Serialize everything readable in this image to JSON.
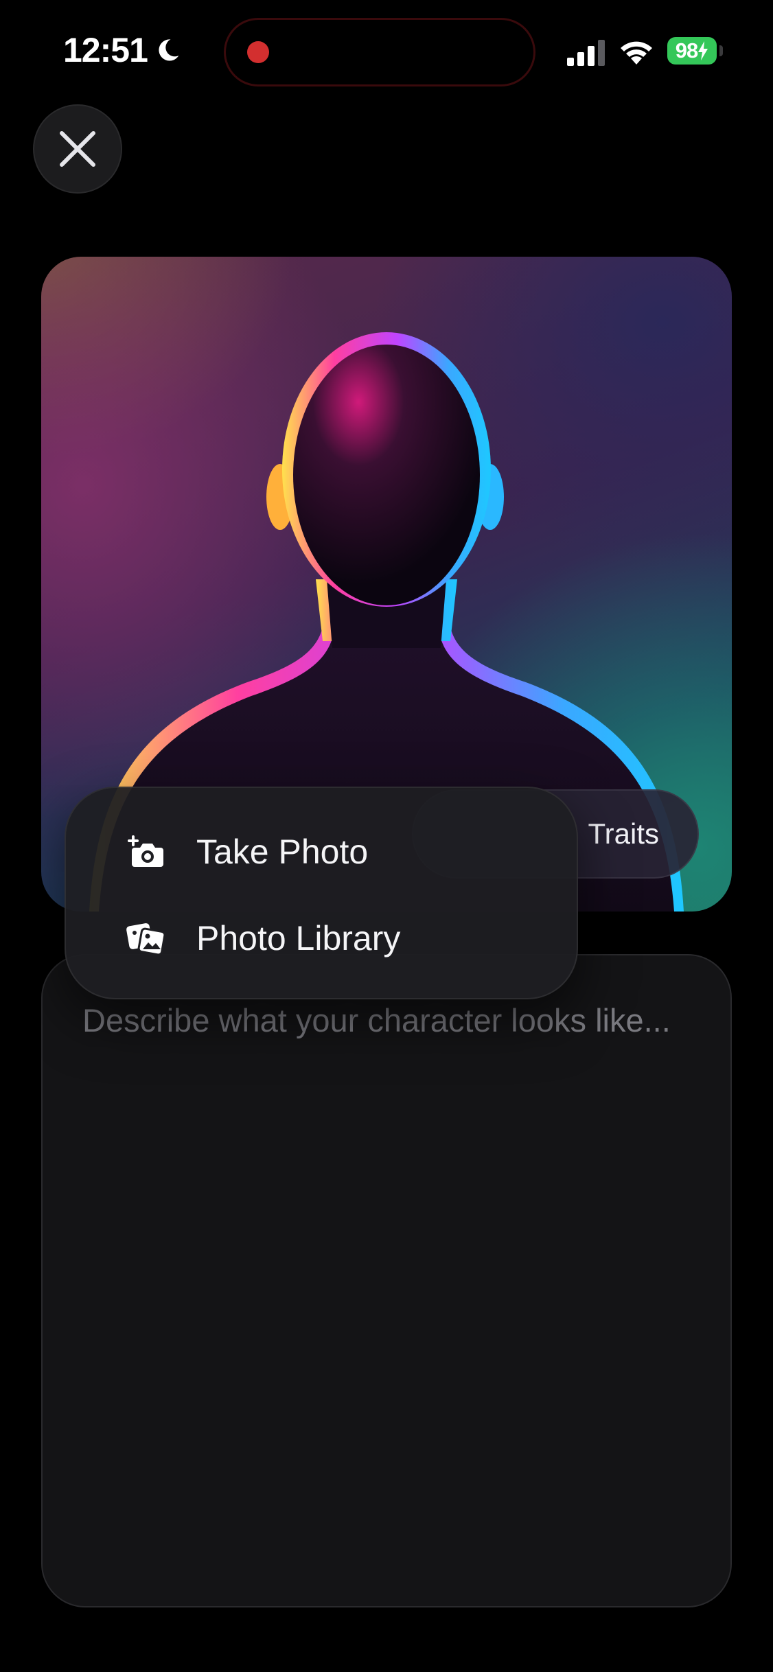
{
  "status_bar": {
    "time": "12:51",
    "battery": "98"
  },
  "avatar": {
    "traits_label": "Traits"
  },
  "photo_menu": {
    "items": [
      {
        "label": "Take Photo",
        "icon": "camera-plus-icon"
      },
      {
        "label": "Photo Library",
        "icon": "photo-library-icon"
      }
    ]
  },
  "description": {
    "placeholder": "Describe what your character looks like...",
    "value": ""
  },
  "colors": {
    "background": "#000000",
    "battery": "#34c759",
    "record_dot": "#d32f2f",
    "panel": "#141416",
    "menu": "#1e1e22"
  }
}
